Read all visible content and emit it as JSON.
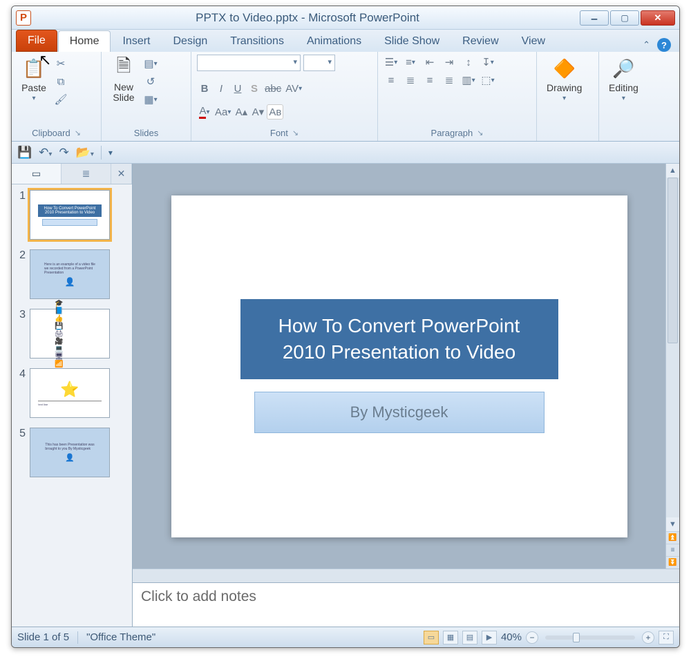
{
  "window": {
    "title": "PPTX to Video.pptx - Microsoft PowerPoint"
  },
  "ribbon": {
    "tabs": {
      "file": "File",
      "home": "Home",
      "insert": "Insert",
      "design": "Design",
      "transitions": "Transitions",
      "animations": "Animations",
      "slideshow": "Slide Show",
      "review": "Review",
      "view": "View"
    },
    "groups": {
      "clipboard": {
        "label": "Clipboard",
        "paste": "Paste"
      },
      "slides": {
        "label": "Slides",
        "newslide": "New\nSlide"
      },
      "font": {
        "label": "Font"
      },
      "paragraph": {
        "label": "Paragraph"
      },
      "drawing": {
        "label": "Drawing"
      },
      "editing": {
        "label": "Editing"
      }
    }
  },
  "slide": {
    "title": "How To Convert PowerPoint 2010 Presentation to Video",
    "subtitle": "By Mysticgeek"
  },
  "thumbnails": [
    "1",
    "2",
    "3",
    "4",
    "5"
  ],
  "notes": {
    "placeholder": "Click to add notes"
  },
  "status": {
    "slide": "Slide 1 of 5",
    "theme": "\"Office Theme\"",
    "zoom": "40%"
  }
}
